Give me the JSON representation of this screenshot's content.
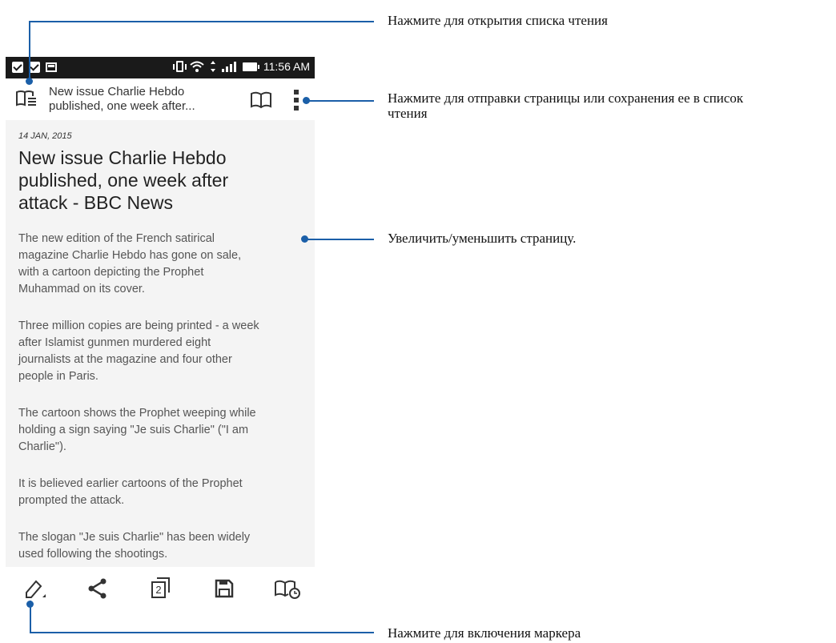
{
  "status_bar": {
    "time": "11:56 AM"
  },
  "toolbar": {
    "title_line1": "New issue Charlie Hebdo",
    "title_line2": "published, one week after..."
  },
  "article": {
    "date": "14 JAN, 2015",
    "headline_line1": "New issue Charlie Hebdo",
    "headline_line2": "published, one week after",
    "headline_line3": "attack - BBC News",
    "paragraphs": [
      [
        "The new edition of the French satirical",
        "magazine Charlie Hebdo has gone on sale,",
        "with a cartoon depicting the Prophet",
        "Muhammad on its cover."
      ],
      [
        "Three million copies are being printed - a week",
        "after Islamist gunmen murdered eight",
        "journalists at the magazine and four other",
        "people in Paris."
      ],
      [
        "The cartoon shows the Prophet weeping while",
        "holding a sign saying \"Je suis Charlie\" (\"I am",
        "Charlie\")."
      ],
      [
        "It is believed earlier cartoons of the Prophet",
        "prompted the attack."
      ],
      [
        "The slogan \"Je suis Charlie\" has been widely",
        "used following the shootings."
      ]
    ]
  },
  "bottom_bar": {
    "page_count": "2"
  },
  "callouts": {
    "reading_list": "Нажмите для открытия списка чтения",
    "share_save_line1": "Нажмите для отправки страницы или сохранения ее в список",
    "share_save_line2": "чтения",
    "zoom": "Увеличить/уменьшить страницу.",
    "highlighter": "Нажмите для включения маркера"
  },
  "colors": {
    "callout_line": "#1b5fa8",
    "status_bar": "#1a1a1a",
    "content_bg": "#f4f4f4"
  }
}
